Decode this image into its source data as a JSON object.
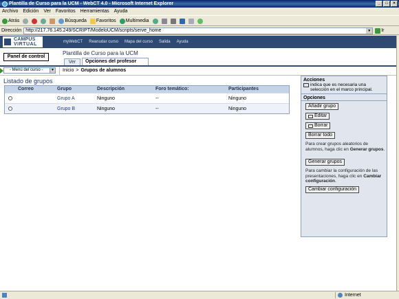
{
  "window": {
    "title": "Plantilla de Curso para la UCM - WebCT 4.0 - Microsoft Internet Explorer"
  },
  "menubar": [
    "Archivo",
    "Edición",
    "Ver",
    "Favoritos",
    "Herramientas",
    "Ayuda"
  ],
  "toolbar": {
    "back": "Atrás",
    "search": "Búsqueda",
    "favorites": "Favoritos",
    "multimedia": "Multimedia"
  },
  "address": {
    "label": "Dirección",
    "url": "http://217.76.145.249/SCRIPT/ModeloUCM/scripts/serve_home",
    "go": "Ir"
  },
  "banner": {
    "logo_line1": "CAMPUS",
    "logo_line2": "VIRTUAL",
    "nav": [
      "myWebCT",
      "Reanudar curso",
      "Mapa del curso",
      "Salida",
      "Ayuda"
    ]
  },
  "course": {
    "panel_button": "Panel de control",
    "title": "Plantilla de Curso para la UCM",
    "tabs": [
      "Ver",
      "Opciones del profesor"
    ]
  },
  "nav": {
    "menu_select": "- Menú del curso -",
    "breadcrumb_home": "Inicio",
    "breadcrumb_sep": ">",
    "breadcrumb_current": "Grupos de alumnos"
  },
  "groups": {
    "title": "Listado de grupos",
    "columns": [
      "Correo",
      "Grupo",
      "Descripción",
      "Foro temático:",
      "Participantes"
    ],
    "rows": [
      {
        "group": "Grupo A",
        "description": "Ninguno",
        "forum": "--",
        "participants": "Ninguno"
      },
      {
        "group": "Grupo B",
        "description": "Ninguno",
        "forum": "--",
        "participants": "Ninguno"
      }
    ]
  },
  "actions": {
    "title": "Acciones",
    "note": "indica que es necesaria una selección en el marco principal.",
    "options_title": "Opciones",
    "add_group": "Añadir grupo",
    "edit": "Editar",
    "delete": "Borrar",
    "delete_all": "Borrar todo",
    "generate_text_pre": "Para crear grupos aleatorios de alumnos, haga clic en",
    "generate_text_bold": "Generar grupos",
    "generate_text_post": ".",
    "generate_groups": "Generar grupos",
    "config_text_pre": "Para cambiar la configuración de las presentaciones, haga clic en",
    "config_text_bold": "Cambiar configuración",
    "config_text_post": ".",
    "change_config": "Cambiar configuración"
  },
  "status": {
    "zone": "Internet"
  }
}
